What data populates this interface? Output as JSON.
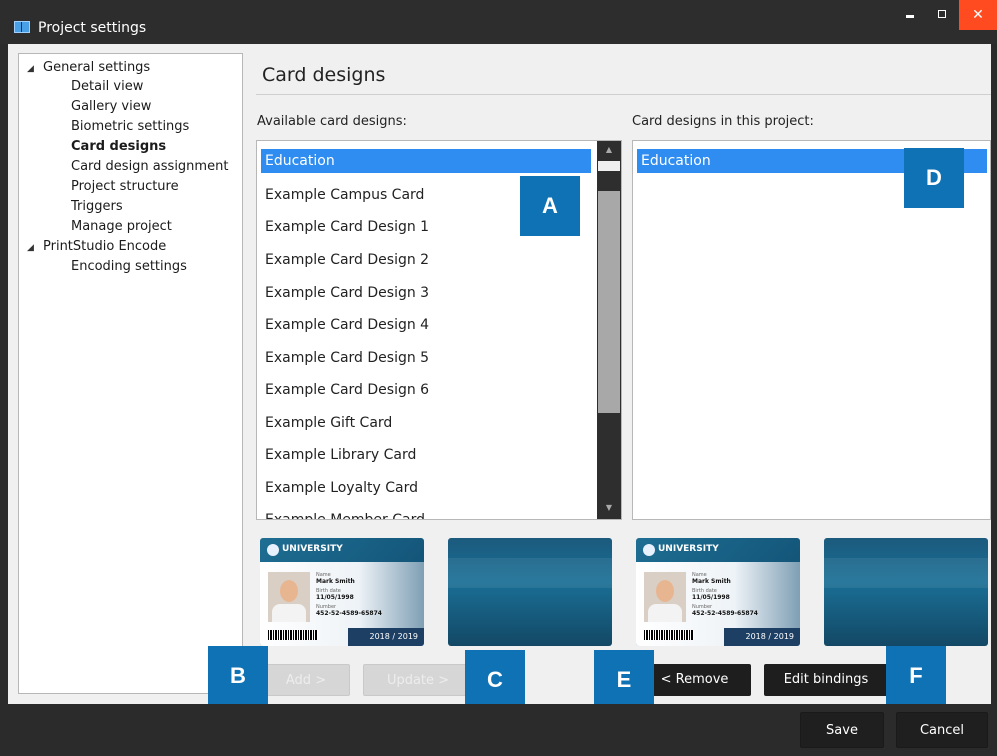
{
  "window": {
    "title": "Project settings",
    "controls": {
      "minimize": "",
      "maximize": "",
      "close": "✕"
    }
  },
  "tree": {
    "groups": [
      {
        "label": "General settings",
        "expanded": true
      },
      {
        "label": "PrintStudio Encode",
        "expanded": true
      }
    ],
    "items": [
      {
        "label": "Detail view"
      },
      {
        "label": "Gallery view"
      },
      {
        "label": "Biometric settings"
      },
      {
        "label": "Card designs",
        "selected": true
      },
      {
        "label": "Card design assignment"
      },
      {
        "label": "Project structure"
      },
      {
        "label": "Triggers"
      },
      {
        "label": "Manage project"
      },
      {
        "label": "Encoding settings"
      }
    ],
    "expander_glyph": "◢"
  },
  "page": {
    "title": "Card designs",
    "available_label": "Available card designs:",
    "project_label": "Card designs in this project:"
  },
  "available": {
    "items": [
      "Education",
      "Example Campus Card",
      "Example Card Design 1",
      "Example Card Design 2",
      "Example Card Design 3",
      "Example Card Design 4",
      "Example Card Design 5",
      "Example Card Design 6",
      "Example Gift Card",
      "Example Library Card",
      "Example Loyalty Card",
      "Example Member Card"
    ],
    "selected_index": 0,
    "scroll_up": "▲",
    "scroll_down": "▼"
  },
  "project": {
    "items": [
      "Education"
    ],
    "selected_index": 0
  },
  "card_preview": {
    "university": "UNIVERSITY",
    "name_caption": "Name",
    "name": "Mark Smith",
    "dob_caption": "Birth date",
    "dob": "11/05/1998",
    "number_caption": "Number",
    "number": "452-52-4589-65874",
    "year": "2018 / 2019"
  },
  "buttons": {
    "add": "Add >",
    "update": "Update >",
    "remove": "< Remove",
    "edit_bindings": "Edit bindings",
    "save": "Save",
    "cancel": "Cancel"
  },
  "callouts": {
    "a": "A",
    "b": "B",
    "c": "C",
    "d": "D",
    "e": "E",
    "f": "F"
  },
  "colors": {
    "selection": "#2f8cf0",
    "callout": "#0e72b5",
    "close": "#ff4b1f"
  }
}
